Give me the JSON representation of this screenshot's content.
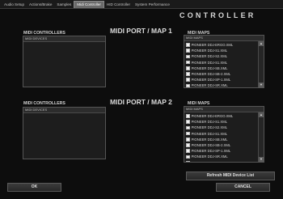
{
  "tabs": [
    "Audio Setup",
    "Actions/Brake",
    "Samples",
    "Midi Controller",
    "HID Controller",
    "System Performance"
  ],
  "active_tab": "Midi Controller",
  "app_title": "CONTROLLER",
  "port1": {
    "title": "MIDI PORT / MAP 1",
    "controllers_label": "MIDI CONTROLLERS",
    "devices_header": "MIDI DEVICES",
    "maps_label": "MIDI MAPS",
    "maps_header": "MIDI MAPS",
    "maps": [
      "PIONEER DDJ-ERGO.XML",
      "PIONEER DDJ-S1.XML",
      "PIONEER DDJ-S2.XML",
      "PIONEER DDJ-S1.XML",
      "PIONEER DDJ-SB.XML",
      "PIONEER DDJ-SB-2.XML",
      "PIONEER DDJ-SP-1.XML",
      "PIONEER DDJ-SR.XML",
      "PIONEER DDJ-S1.XML"
    ]
  },
  "port2": {
    "title": "MIDI PORT / MAP 2",
    "controllers_label": "MIDI CONTROLLERS",
    "devices_header": "MIDI DEVICES",
    "maps_label": "MIDI MAPS",
    "maps_header": "MIDI MAPS",
    "maps": [
      "PIONEER DDJ-ERGO.XML",
      "PIONEER DDJ-S1.XML",
      "PIONEER DDJ-S2.XML",
      "PIONEER DDJ-S1.XML",
      "PIONEER DDJ-SB.XML",
      "PIONEER DDJ-SB-2.XML",
      "PIONEER DDJ-SP-1.XML",
      "PIONEER DDJ-SR.XML",
      "PIONEER DDJ-S1.XML"
    ]
  },
  "buttons": {
    "refresh": "Refresh MIDI Device List",
    "ok": "OK",
    "cancel": "CANCEL"
  }
}
